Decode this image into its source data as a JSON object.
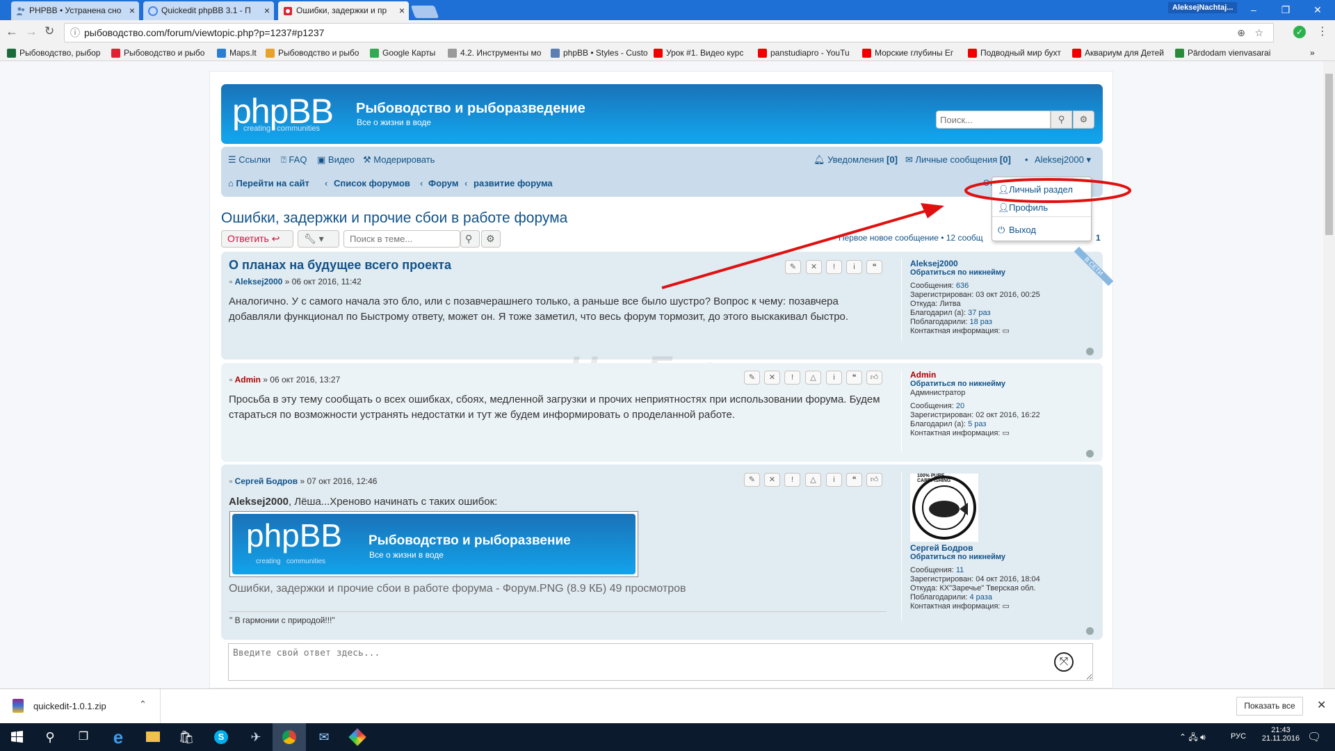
{
  "browser": {
    "tabs": [
      {
        "label": "PHPBB • Устранена сно"
      },
      {
        "label": "Quickedit phpBB 3.1 - П"
      },
      {
        "label": "Ошибки, задержки и пр"
      }
    ],
    "window_user": "AleksejNachtaj...",
    "url": "рыбоводство.com/forum/viewtopic.php?p=1237#p1237",
    "bookmarks": [
      "Рыбоводство, рыбор",
      "Рыбоводство и рыбо",
      "Maps.lt",
      "Рыбоводство и рыбо",
      "Google Карты",
      "4.2. Инструменты мо",
      "phpBB • Styles - Custo",
      "Урок #1. Видео курс",
      "panstudiapro - YouTu",
      "Морские глубины Ег",
      "Подводный мир бухт",
      "Аквариум для Детей",
      "Pārdodam vienvasarai"
    ],
    "bookmarks_more": "»"
  },
  "forum": {
    "logo_text": "phpBB",
    "logo_sub": "creating   communities",
    "site_title": "Рыбоводство и рыборазведение",
    "site_desc": "Все о жизни в воде",
    "search_placeholder": "Поиск...",
    "nav": {
      "links": "Ссылки",
      "faq": "FAQ",
      "video": "Видео",
      "moderate": "Модерировать",
      "notifications": "Уведомления",
      "notifications_count": "[0]",
      "messages": "Личные сообщения",
      "messages_count": "[0]",
      "bullet": "•",
      "user": "Aleksej2000 ▾"
    },
    "breadcrumbs": [
      "Перейти на сайт",
      "Список форумов",
      "Форум",
      "развитие форума"
    ],
    "crumb_sep": "‹",
    "nav_partial": "Ст",
    "dropdown": {
      "personal": "Личный раздел",
      "profile": "Профиль",
      "logout": "Выход"
    },
    "topic_title": "Ошибки, задержки и прочие сбои в работе форума",
    "reply_button": "Ответить",
    "topic_search_placeholder": "Поиск в теме...",
    "pagination": "Первое новое сообщение • 12 сообщ",
    "page_num": "1",
    "watermark": "ЧипГуру",
    "posts": [
      {
        "title": "О планах на будущее всего проекта",
        "author": "Aleksej2000",
        "date": "» 06 окт 2016, 11:42",
        "text": "Аналогично. У с самого начала это бло, или с позавчерашнего только, а раньше все было шустро? Вопрос к чему: позавчера добавляли функционал по Быстрому ответу, может он. Я тоже заметил, что весь форум тормозит, до этого выскакивал быстро.",
        "online": "В СЕТИ",
        "profile": {
          "name": "Aleksej2000",
          "contact": "Обратиться по никнейму",
          "rows": [
            [
              "Сообщения:",
              "636"
            ],
            [
              "Зарегистрирован:",
              "03 окт 2016, 00:25"
            ],
            [
              "Откуда:",
              "Литва"
            ],
            [
              "Благодарил (а):",
              "37 раз"
            ],
            [
              "Поблагодарили:",
              "18 раз"
            ],
            [
              "Контактная информация:",
              ""
            ]
          ]
        }
      },
      {
        "author": "Admin",
        "date": "» 06 окт 2016, 13:27",
        "text": "Просьба в эту тему сообщать о всех ошибках, сбоях, медленной загрузки и прочих неприятностях при использовании форума. Будем стараться по возможности устранять недостатки и тут же будем информировать о проделанной работе.",
        "profile": {
          "name": "Admin",
          "contact": "Обратиться по никнейму",
          "rank": "Администратор",
          "rows": [
            [
              "Сообщения:",
              "20"
            ],
            [
              "Зарегистрирован:",
              "02 окт 2016, 16:22"
            ],
            [
              "Благодарил (а):",
              "5 раз"
            ],
            [
              "Контактная информация:",
              ""
            ]
          ]
        }
      },
      {
        "author": "Сергей Бодров",
        "date": "» 07 окт 2016, 12:46",
        "quote_name": "Aleksej2000",
        "text": ", Лёша...Хреново начинать с таких ошибок:",
        "attach_title": "Рыбоводство и рыборазвение",
        "attach_desc": "Все о жизни в воде",
        "attach_caption": "Ошибки, задержки и прочие сбои в работе форума - Форум.PNG (8.9 КБ) 49 просмотров",
        "signature": "\" В гармонии с природой!!!\"",
        "avatar_text": "100% PURE CARPFISHING",
        "profile": {
          "name": "Сергей Бодров",
          "contact": "Обратиться по никнейму",
          "rows": [
            [
              "Сообщения:",
              "11"
            ],
            [
              "Зарегистрирован:",
              "04 окт 2016, 18:04"
            ],
            [
              "Откуда:",
              "КХ\"Заречье\" Тверская обл."
            ],
            [
              "Поблагодарили:",
              "4 раза"
            ],
            [
              "Контактная информация:",
              ""
            ]
          ]
        }
      }
    ],
    "reply_placeholder": "Введите свой ответ здесь..."
  },
  "downloads": {
    "file": "quickedit-1.0.1.zip",
    "show_all": "Показать все"
  },
  "taskbar": {
    "lang": "РУС",
    "time": "21:43",
    "date": "21.11.2016"
  },
  "colors": {
    "annotation": "#e01010",
    "header": "#1a72b8",
    "link": "#105289"
  }
}
